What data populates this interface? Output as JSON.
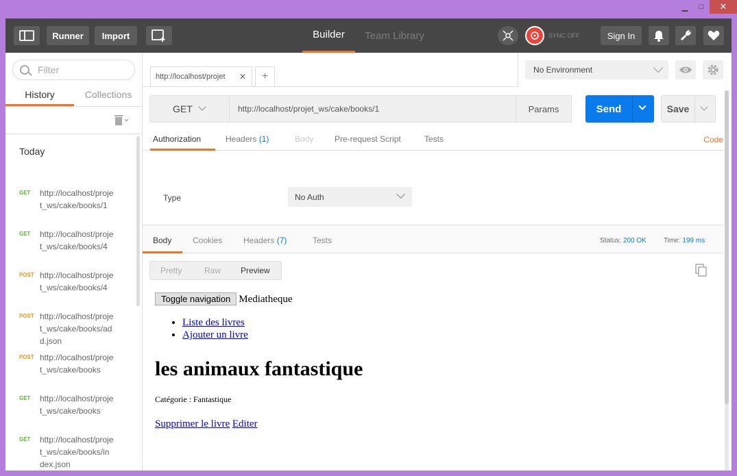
{
  "window": {
    "minimize": "▁",
    "maximize": "□",
    "close": "✕"
  },
  "toolbar": {
    "runner_label": "Runner",
    "import_label": "Import",
    "builder_tab": "Builder",
    "team_library_tab": "Team Library",
    "sync_label": "SYNC OFF",
    "signin_label": "Sign In",
    "accent": "#f47023"
  },
  "sidebar": {
    "filter_placeholder": "Filter",
    "tabs": [
      "History",
      "Collections"
    ],
    "section": "Today",
    "history": [
      {
        "method": "GET",
        "url": "http://localhost/projet_ws/cake/books/1"
      },
      {
        "method": "GET",
        "url": "http://localhost/projet_ws/cake/books/4"
      },
      {
        "method": "POST",
        "url": "http://localhost/projet_ws/cake/books/4"
      },
      {
        "method": "POST",
        "url": "http://localhost/projet_ws/cake/books/add.json"
      },
      {
        "method": "POST",
        "url": "http://localhost/projet_ws/cake/books"
      },
      {
        "method": "GET",
        "url": "http://localhost/projet_ws/cake/books"
      },
      {
        "method": "GET",
        "url": "http://localhost/projet_ws/cake/books/index.json"
      }
    ]
  },
  "request": {
    "tab_title": "http://localhost/projet",
    "environment": "No Environment",
    "method": "GET",
    "url": "http://localhost/projet_ws/cake/books/1",
    "params_label": "Params",
    "send_label": "Send",
    "save_label": "Save",
    "send_color": "#097bed",
    "tabs": {
      "authorization": "Authorization",
      "headers": "Headers",
      "headers_count": "(1)",
      "body": "Body",
      "prerequest": "Pre-request Script",
      "tests": "Tests"
    },
    "code_link": "Code",
    "auth_type_label": "Type",
    "auth_type_value": "No Auth"
  },
  "response": {
    "tabs": {
      "body": "Body",
      "cookies": "Cookies",
      "headers": "Headers",
      "headers_count": "(7)",
      "tests": "Tests"
    },
    "status_label": "Status:",
    "status_value": "200 OK",
    "time_label": "Time:",
    "time_value": "199 ms",
    "formats": [
      "Pretty",
      "Raw",
      "Preview"
    ],
    "preview": {
      "toggle_button": "Toggle navigation",
      "brand": "Mediatheque",
      "nav_links": [
        "Liste des livres",
        "Ajouter un livre"
      ],
      "title": "les animaux fantastique",
      "category": "Catégorie : Fantastique",
      "delete_link": "Supprimer le livre",
      "edit_link": "Editer"
    }
  }
}
